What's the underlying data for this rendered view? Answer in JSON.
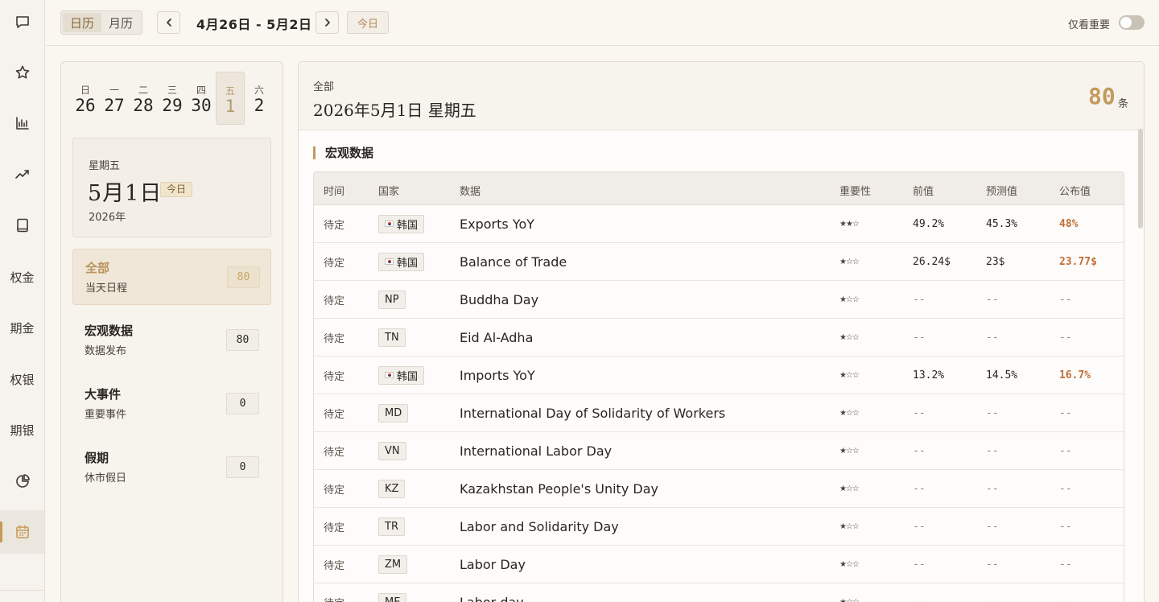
{
  "rail": {
    "items": [
      {
        "name": "chat-icon",
        "type": "icon"
      },
      {
        "name": "star-icon",
        "type": "icon"
      },
      {
        "name": "chart-icon",
        "type": "icon"
      },
      {
        "name": "trend-icon",
        "type": "icon"
      },
      {
        "name": "book-icon",
        "type": "icon"
      },
      {
        "label": "权金",
        "type": "text"
      },
      {
        "label": "期金",
        "type": "text"
      },
      {
        "label": "权银",
        "type": "text"
      },
      {
        "label": "期银",
        "type": "text"
      },
      {
        "name": "pie-icon",
        "type": "icon"
      },
      {
        "name": "calendar-icon",
        "type": "icon",
        "active": true
      }
    ],
    "text_labels": [
      "权金",
      "期金",
      "权银",
      "期银"
    ]
  },
  "topbar": {
    "view_day": "日历",
    "view_month": "月历",
    "range": "4月26日 - 5月2日",
    "today_label": "今日",
    "important_only_label": "仅看重要",
    "important_only": false
  },
  "week": [
    {
      "dow": "日",
      "day": "26"
    },
    {
      "dow": "一",
      "day": "27"
    },
    {
      "dow": "二",
      "day": "28"
    },
    {
      "dow": "三",
      "day": "29"
    },
    {
      "dow": "四",
      "day": "30"
    },
    {
      "dow": "五",
      "day": "1",
      "selected": true
    },
    {
      "dow": "六",
      "day": "2"
    }
  ],
  "date_card": {
    "weekday": "星期五",
    "date": "5月1日",
    "badge": "今日",
    "year": "2026年"
  },
  "categories": [
    {
      "title": "全部",
      "subtitle": "当天日程",
      "count": "80",
      "selected": true
    },
    {
      "title": "宏观数据",
      "subtitle": "数据发布",
      "count": "80"
    },
    {
      "title": "大事件",
      "subtitle": "重要事件",
      "count": "0"
    },
    {
      "title": "假期",
      "subtitle": "休市假日",
      "count": "0"
    }
  ],
  "main": {
    "category": "全部",
    "date_title": "2026年5月1日 星期五",
    "count": "80",
    "count_unit": "条",
    "section_title": "宏观数据",
    "columns": [
      "时间",
      "国家",
      "数据",
      "重要性",
      "前值",
      "预测值",
      "公布值"
    ],
    "rows": [
      {
        "time": "待定",
        "country": "韩国",
        "flag": true,
        "name": "Exports YoY",
        "importance": "★★☆",
        "stars": 2,
        "prev": "49.2%",
        "forecast": "45.3%",
        "actual": "48%",
        "highlight": true
      },
      {
        "time": "待定",
        "country": "韩国",
        "flag": true,
        "name": "Balance of Trade",
        "importance": "★☆☆",
        "stars": 1,
        "prev": "26.24$",
        "forecast": "23$",
        "actual": "23.77$",
        "highlight": true
      },
      {
        "time": "待定",
        "country": "NP",
        "name": "Buddha Day",
        "importance": "★☆☆",
        "stars": 1,
        "prev": "--",
        "forecast": "--",
        "actual": "--"
      },
      {
        "time": "待定",
        "country": "TN",
        "name": "Eid Al-Adha",
        "importance": "★☆☆",
        "stars": 1,
        "prev": "--",
        "forecast": "--",
        "actual": "--"
      },
      {
        "time": "待定",
        "country": "韩国",
        "flag": true,
        "name": "Imports YoY",
        "importance": "★☆☆",
        "stars": 1,
        "prev": "13.2%",
        "forecast": "14.5%",
        "actual": "16.7%",
        "highlight": true
      },
      {
        "time": "待定",
        "country": "MD",
        "name": "International Day of Solidarity of Workers",
        "importance": "★☆☆",
        "stars": 1,
        "prev": "--",
        "forecast": "--",
        "actual": "--"
      },
      {
        "time": "待定",
        "country": "VN",
        "name": "International Labor Day",
        "importance": "★☆☆",
        "stars": 1,
        "prev": "--",
        "forecast": "--",
        "actual": "--"
      },
      {
        "time": "待定",
        "country": "KZ",
        "name": "Kazakhstan People's Unity Day",
        "importance": "★☆☆",
        "stars": 1,
        "prev": "--",
        "forecast": "--",
        "actual": "--"
      },
      {
        "time": "待定",
        "country": "TR",
        "name": "Labor and Solidarity Day",
        "importance": "★☆☆",
        "stars": 1,
        "prev": "--",
        "forecast": "--",
        "actual": "--"
      },
      {
        "time": "待定",
        "country": "ZM",
        "name": "Labor Day",
        "importance": "★☆☆",
        "stars": 1,
        "prev": "--",
        "forecast": "--",
        "actual": "--"
      },
      {
        "time": "待定",
        "country": "ME",
        "name": "Labor day",
        "importance": "★☆☆",
        "stars": 1,
        "prev": "--",
        "forecast": "--",
        "actual": "--"
      }
    ]
  },
  "colors": {
    "accent": "#c49a5b",
    "highlight": "#c0703a"
  }
}
